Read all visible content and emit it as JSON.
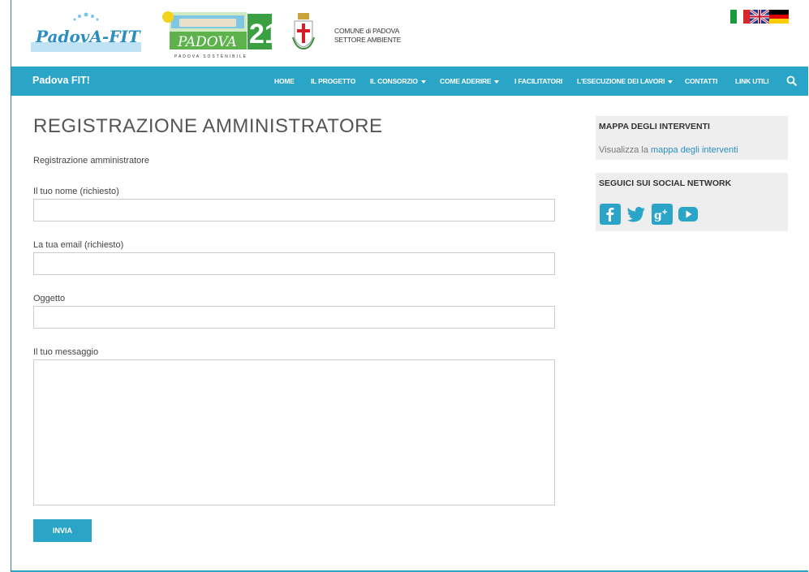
{
  "header": {
    "comune_line1": "COMUNE di PADOVA",
    "comune_line2": "SETTORE AMBIENTE",
    "logo1_text": "PadovA-FIT",
    "logo2_text": "PADOVA",
    "logo2_num": "21",
    "logo2_sub": "PADOVA SOSTENIBILE"
  },
  "nav": {
    "brand": "Padova FIT!",
    "items": [
      {
        "label": "HOME",
        "dropdown": false
      },
      {
        "label": "IL PROGETTO",
        "dropdown": false
      },
      {
        "label": "IL CONSORZIO",
        "dropdown": true
      },
      {
        "label": "COME ADERIRE",
        "dropdown": true
      },
      {
        "label": "I FACILITATORI",
        "dropdown": false
      },
      {
        "label": "L'ESECUZIONE DEI LAVORI",
        "dropdown": true
      },
      {
        "label": "CONTATTI",
        "dropdown": false
      },
      {
        "label": "LINK UTILI",
        "dropdown": false
      }
    ]
  },
  "main": {
    "title": "REGISTRAZIONE AMMINISTRATORE",
    "subtitle": "Registrazione amministratore",
    "fields": {
      "name_label": "Il tuo nome (richiesto)",
      "name_value": "",
      "email_label": "La tua email (richiesto)",
      "email_value": "",
      "subject_label": "Oggetto",
      "subject_value": "",
      "message_label": "Il tuo messaggio",
      "message_value": ""
    },
    "submit_label": "INVIA"
  },
  "sidebar": {
    "map_title": "MAPPA DEGLI INTERVENTI",
    "map_text": "Visualizza la ",
    "map_link": "mappa degli interventi",
    "social_title": "SEGUICI SUI SOCIAL NETWORK",
    "social_icons": [
      "facebook-icon",
      "twitter-icon",
      "google-plus-icon",
      "youtube-icon"
    ]
  },
  "colors": {
    "accent": "#2aa5c8",
    "link": "#2a8fc0",
    "widget_bg": "#eeeeee"
  }
}
